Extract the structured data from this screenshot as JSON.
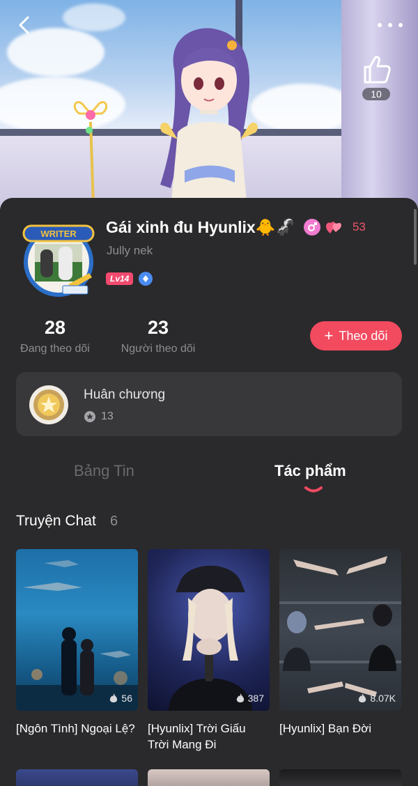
{
  "header": {
    "back_icon": "chevron-left-icon",
    "more_icon": "more-dots-icon",
    "like_icon": "thumbs-up-icon",
    "like_count": "10"
  },
  "profile": {
    "name": "Gái xinh đu Hyunlix🐥🦨",
    "heart_count": "53",
    "bio": "Jully nek",
    "level": "Lv14",
    "avatar_badge": "WRITER"
  },
  "stats": {
    "following_count": "28",
    "following_label": "Đang theo dõi",
    "followers_count": "23",
    "followers_label": "Người theo dõi"
  },
  "follow_button": {
    "icon": "+",
    "label": "Theo dõi"
  },
  "medals": {
    "title": "Huân chương",
    "count": "13"
  },
  "tabs": [
    {
      "label": "Bảng Tin",
      "active": false
    },
    {
      "label": "Tác phẩm",
      "active": true
    }
  ],
  "section": {
    "title": "Truyện Chat",
    "count": "6"
  },
  "stories": [
    {
      "title": "[Ngôn Tình] Ngoại Lệ?",
      "views": "56"
    },
    {
      "title": "[Hyunlix] Trời Giấu Trời Mang Đi",
      "views": "387"
    },
    {
      "title": "[Hyunlix] Bạn Đời",
      "views": "8.07K"
    }
  ],
  "colors": {
    "accent": "#f24a5f",
    "background": "#2a2a2c",
    "card": "#38383b"
  }
}
